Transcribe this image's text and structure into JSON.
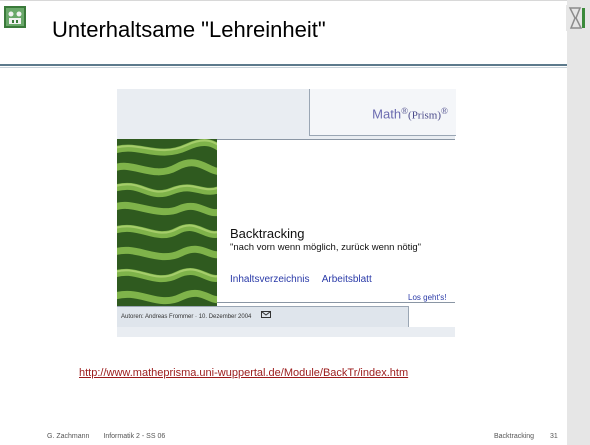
{
  "slide": {
    "title": "Unterhaltsame \"Lehreinheit\"",
    "url": "http://www.matheprisma.uni-wuppertal.de/Module/BackTr/index.htm"
  },
  "embed": {
    "logo_math": "Math",
    "logo_sup1": "®",
    "logo_prism": "(Prism)",
    "logo_sup2": "®",
    "heading": "Backtracking",
    "subtitle": "\"nach vorn wenn möglich, zurück wenn nötig\"",
    "link_contents": "Inhaltsverzeichnis",
    "link_worksheet": "Arbeitsblatt",
    "link_start": "Los geht's!",
    "authors": "Autoren: Andreas Frommer · 10. Dezember 2004"
  },
  "footer": {
    "author": "G. Zachmann",
    "course": "Informatik 2 - SS 06",
    "topic": "Backtracking",
    "page": "31"
  },
  "colors": {
    "accent_rule": "#5d7a8c",
    "link_blue": "#2a3aa8",
    "url_red": "#9b1a1a"
  }
}
